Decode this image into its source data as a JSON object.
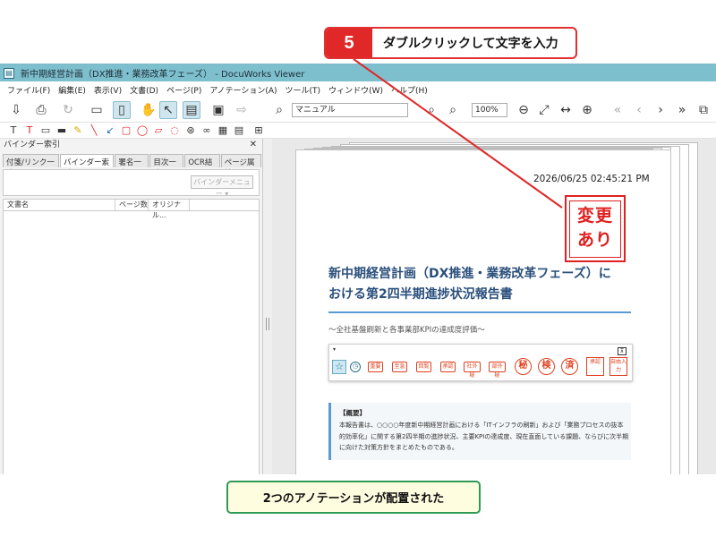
{
  "callout_step": {
    "number": "5",
    "text": "ダブルクリックして文字を入力"
  },
  "callout_bottom": "2つのアノテーションが配置された",
  "window": {
    "title": "新中期経営計画（DX推進・業務改革フェーズ） - DocuWorks Viewer"
  },
  "menu": [
    "ファイル(F)",
    "編集(E)",
    "表示(V)",
    "文書(D)",
    "ページ(P)",
    "アノテーション(A)",
    "ツール(T)",
    "ウィンドウ(W)",
    "ヘルプ(H)"
  ],
  "toolbar": {
    "search_value": "マニュアル",
    "zoom_value": "100%",
    "rotate_label": "90°"
  },
  "left_panel": {
    "title": "バインダー索引",
    "tabs": [
      "付箋/リンク一覧",
      "バインダー索引",
      "署名一覧",
      "目次一覧",
      "OCR結果",
      "ページ属性"
    ],
    "binder_menu": "バインダーメニュー",
    "columns": [
      "文書名",
      "ページ数",
      "オリジナル..."
    ]
  },
  "document": {
    "timestamp": "2026/06/25 02:45:21 PM",
    "stamp_text": "変更あり",
    "stamp_line1": "変更",
    "stamp_line2": "あり",
    "title_line1": "新中期経営計画（DX推進・業務改革フェーズ）に",
    "title_line2": "おける第2四半期進捗状況報告書",
    "subtitle": "〜全社基盤刷新と各事業部KPIの達成度評価〜",
    "summary_heading": "【概要】",
    "summary_body": "本報告書は、○○○○年度新中期経営計画における「ITインフラの刷新」および「業務プロセスの抜本的効率化」に関する第2四半期の進捗状況、主要KPIの達成度、現在直面している課題、ならびに次半期に向けた対策方針をまとめたものである。"
  },
  "stamp_palette": {
    "items": [
      "重要",
      "至急",
      "回覧",
      "承認",
      "社外秘",
      "部外秘"
    ],
    "circles": [
      "秘",
      "検",
      "済"
    ],
    "boxes": [
      "承認",
      "自由入力"
    ]
  },
  "colors": {
    "accent_red": "#e02828",
    "titlebar": "#7ebfce",
    "title_blue": "#2a4f7c",
    "callout_green": "#2f9a55"
  }
}
